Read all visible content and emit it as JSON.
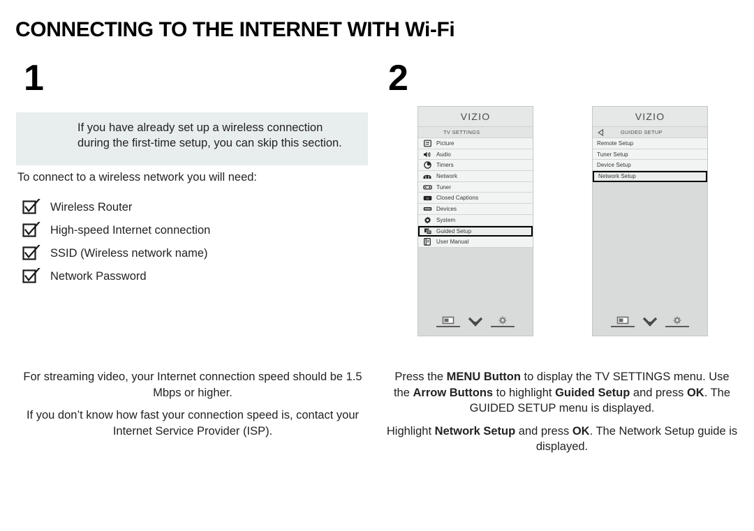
{
  "page": {
    "title": "CONNECTING TO THE INTERNET WITH Wi-Fi"
  },
  "steps": {
    "one": "1",
    "two": "2"
  },
  "left_column": {
    "note": "If you have already set up a wireless connection during the first-time setup, you can skip this section.",
    "intro": "To connect to a wireless network you will need:",
    "requirements": [
      {
        "label": "Wireless Router",
        "icon": "checkbox-checked-icon"
      },
      {
        "label": "High-speed Internet connection",
        "icon": "checkbox-checked-icon"
      },
      {
        "label": "SSID (Wireless network name)",
        "icon": "checkbox-checked-icon"
      },
      {
        "label": "Network Password",
        "icon": "checkbox-checked-icon"
      }
    ],
    "footnote_1": "For streaming video, your Internet connection speed should be 1.5 Mbps or higher.",
    "footnote_2": "If you don’t know how fast your connection speed is, contact your Internet Service Provider (ISP)."
  },
  "tv_screen_1": {
    "logo": "VIZIO",
    "header": "TV SETTINGS",
    "items": [
      {
        "label": "Picture",
        "icon": "picture-icon",
        "selected": false
      },
      {
        "label": "Audio",
        "icon": "speaker-icon",
        "selected": false
      },
      {
        "label": "Timers",
        "icon": "clock-icon",
        "selected": false
      },
      {
        "label": "Network",
        "icon": "network-icon",
        "selected": false
      },
      {
        "label": "Tuner",
        "icon": "tuner-icon",
        "selected": false
      },
      {
        "label": "Closed Captions",
        "icon": "closed-captions-icon",
        "selected": false
      },
      {
        "label": "Devices",
        "icon": "devices-icon",
        "selected": false
      },
      {
        "label": "System",
        "icon": "gear-icon",
        "selected": false
      },
      {
        "label": "Guided Setup",
        "icon": "guided-setup-icon",
        "selected": true
      },
      {
        "label": "User Manual",
        "icon": "manual-icon",
        "selected": false
      }
    ],
    "bottom_icons": [
      "screen-icon",
      "chevron-double-down-icon",
      "brightness-gear-icon"
    ]
  },
  "tv_screen_2": {
    "logo": "VIZIO",
    "header": "GUIDED SETUP",
    "back_icon": "back-arrow-icon",
    "items": [
      {
        "label": "Remote Setup",
        "selected": false
      },
      {
        "label": "Tuner Setup",
        "selected": false
      },
      {
        "label": "Device Setup",
        "selected": false
      },
      {
        "label": "Network Setup",
        "selected": true
      }
    ],
    "bottom_icons": [
      "screen-icon",
      "chevron-double-down-icon",
      "brightness-gear-icon"
    ]
  },
  "right_column": {
    "instruction_1": [
      {
        "text": "Press the ",
        "bold": false
      },
      {
        "text": "MENU Button",
        "bold": true
      },
      {
        "text": " to display the TV SETTINGS menu. Use the ",
        "bold": false
      },
      {
        "text": "Arrow Buttons",
        "bold": true
      },
      {
        "text": " to highlight ",
        "bold": false
      },
      {
        "text": "Guided Setup",
        "bold": true
      },
      {
        "text": " and press ",
        "bold": false
      },
      {
        "text": "OK",
        "bold": true
      },
      {
        "text": ". The GUIDED SETUP menu is displayed.",
        "bold": false
      }
    ],
    "instruction_2": [
      {
        "text": "Highlight ",
        "bold": false
      },
      {
        "text": "Network Setup",
        "bold": true
      },
      {
        "text": " and press ",
        "bold": false
      },
      {
        "text": "OK",
        "bold": true
      },
      {
        "text": ". The Network Setup guide is displayed.",
        "bold": false
      }
    ]
  },
  "colors": {
    "note_bg": "#e8edee",
    "panel_bg": "#d9dbdb",
    "row_bg": "#f2f3f3",
    "selection_border": "#000000"
  }
}
